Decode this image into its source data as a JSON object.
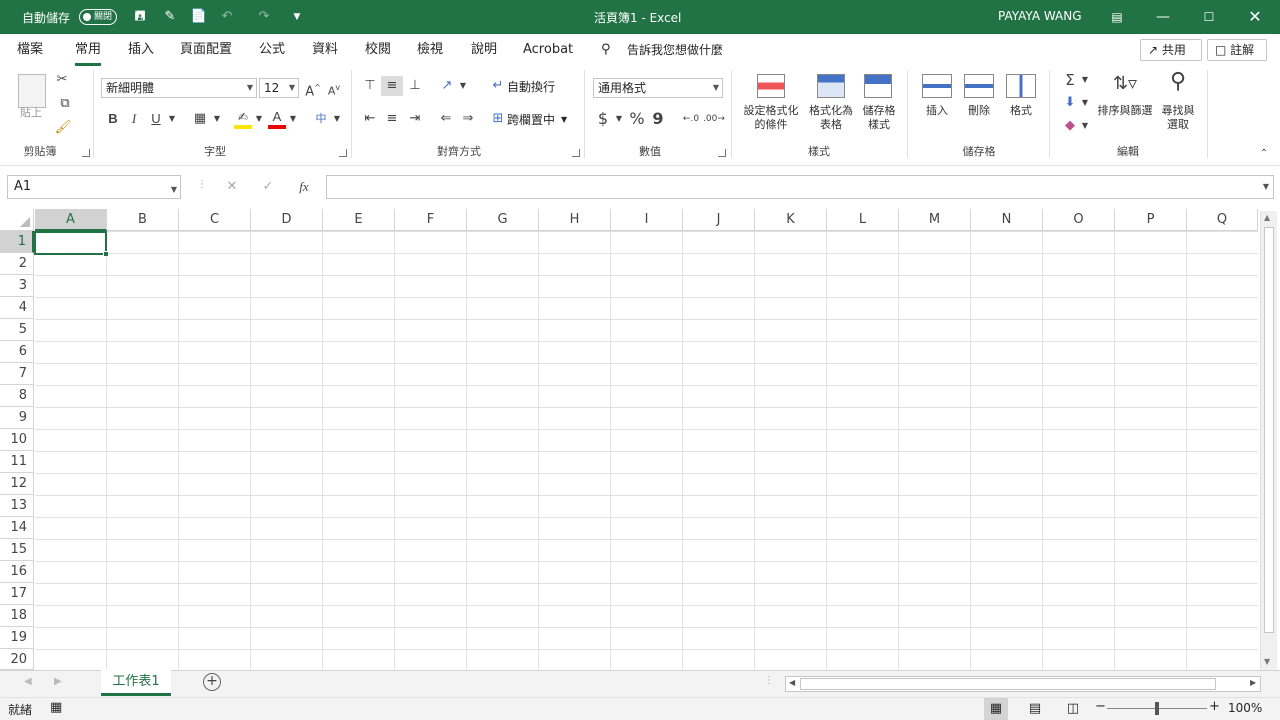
{
  "titlebar": {
    "autosave_label": "自動儲存",
    "autosave_state": "關閉",
    "doc_title": "活頁簿1  -  Excel",
    "user_name": "PAYAYA WANG",
    "qa_save_icon": "save-icon",
    "qa_undo_icon": "undo-icon",
    "qa_redo_icon": "redo-icon"
  },
  "tabs": [
    "檔案",
    "常用",
    "插入",
    "頁面配置",
    "公式",
    "資料",
    "校閱",
    "檢視",
    "說明",
    "Acrobat"
  ],
  "active_tab": "常用",
  "tell_me": "告訴我您想做什麼",
  "share_label": "共用",
  "comment_label": "註解",
  "ribbon": {
    "clipboard": {
      "paste": "貼上",
      "group": "剪貼簿"
    },
    "font": {
      "name": "新細明體",
      "size": "12",
      "group": "字型",
      "bold": "B",
      "italic": "I",
      "underline": "U",
      "grow": "A",
      "shrink": "A",
      "phonetic": "中"
    },
    "alignment": {
      "wrap": "自動換行",
      "merge": "跨欄置中",
      "group": "對齊方式"
    },
    "number": {
      "format": "通用格式",
      "currency": "$",
      "percent": "%",
      "comma": "9",
      "group": "數值"
    },
    "styles": {
      "conditional": "設定格式化\n的條件",
      "as_table": "格式化為\n表格",
      "cell_styles": "儲存格\n樣式",
      "group": "樣式"
    },
    "cells": {
      "insert": "插入",
      "delete": "刪除",
      "format": "格式",
      "group": "儲存格"
    },
    "editing": {
      "sort": "排序與篩選",
      "find": "尋找與\n選取",
      "group": "編輯"
    }
  },
  "namebox": "A1",
  "formula": "",
  "columns": [
    "A",
    "B",
    "C",
    "D",
    "E",
    "F",
    "G",
    "H",
    "I",
    "J",
    "K",
    "L",
    "M",
    "N",
    "O",
    "P",
    "Q"
  ],
  "rows": [
    "1",
    "2",
    "3",
    "4",
    "5",
    "6",
    "7",
    "8",
    "9",
    "10",
    "11",
    "12",
    "13",
    "14",
    "15",
    "16",
    "17",
    "18",
    "19",
    "20"
  ],
  "sheets": [
    "工作表1"
  ],
  "status": {
    "ready": "就緒",
    "zoom": "100%",
    "zoom_level": 1.0
  },
  "colors": {
    "accent": "#217346",
    "selection": "#217346"
  }
}
